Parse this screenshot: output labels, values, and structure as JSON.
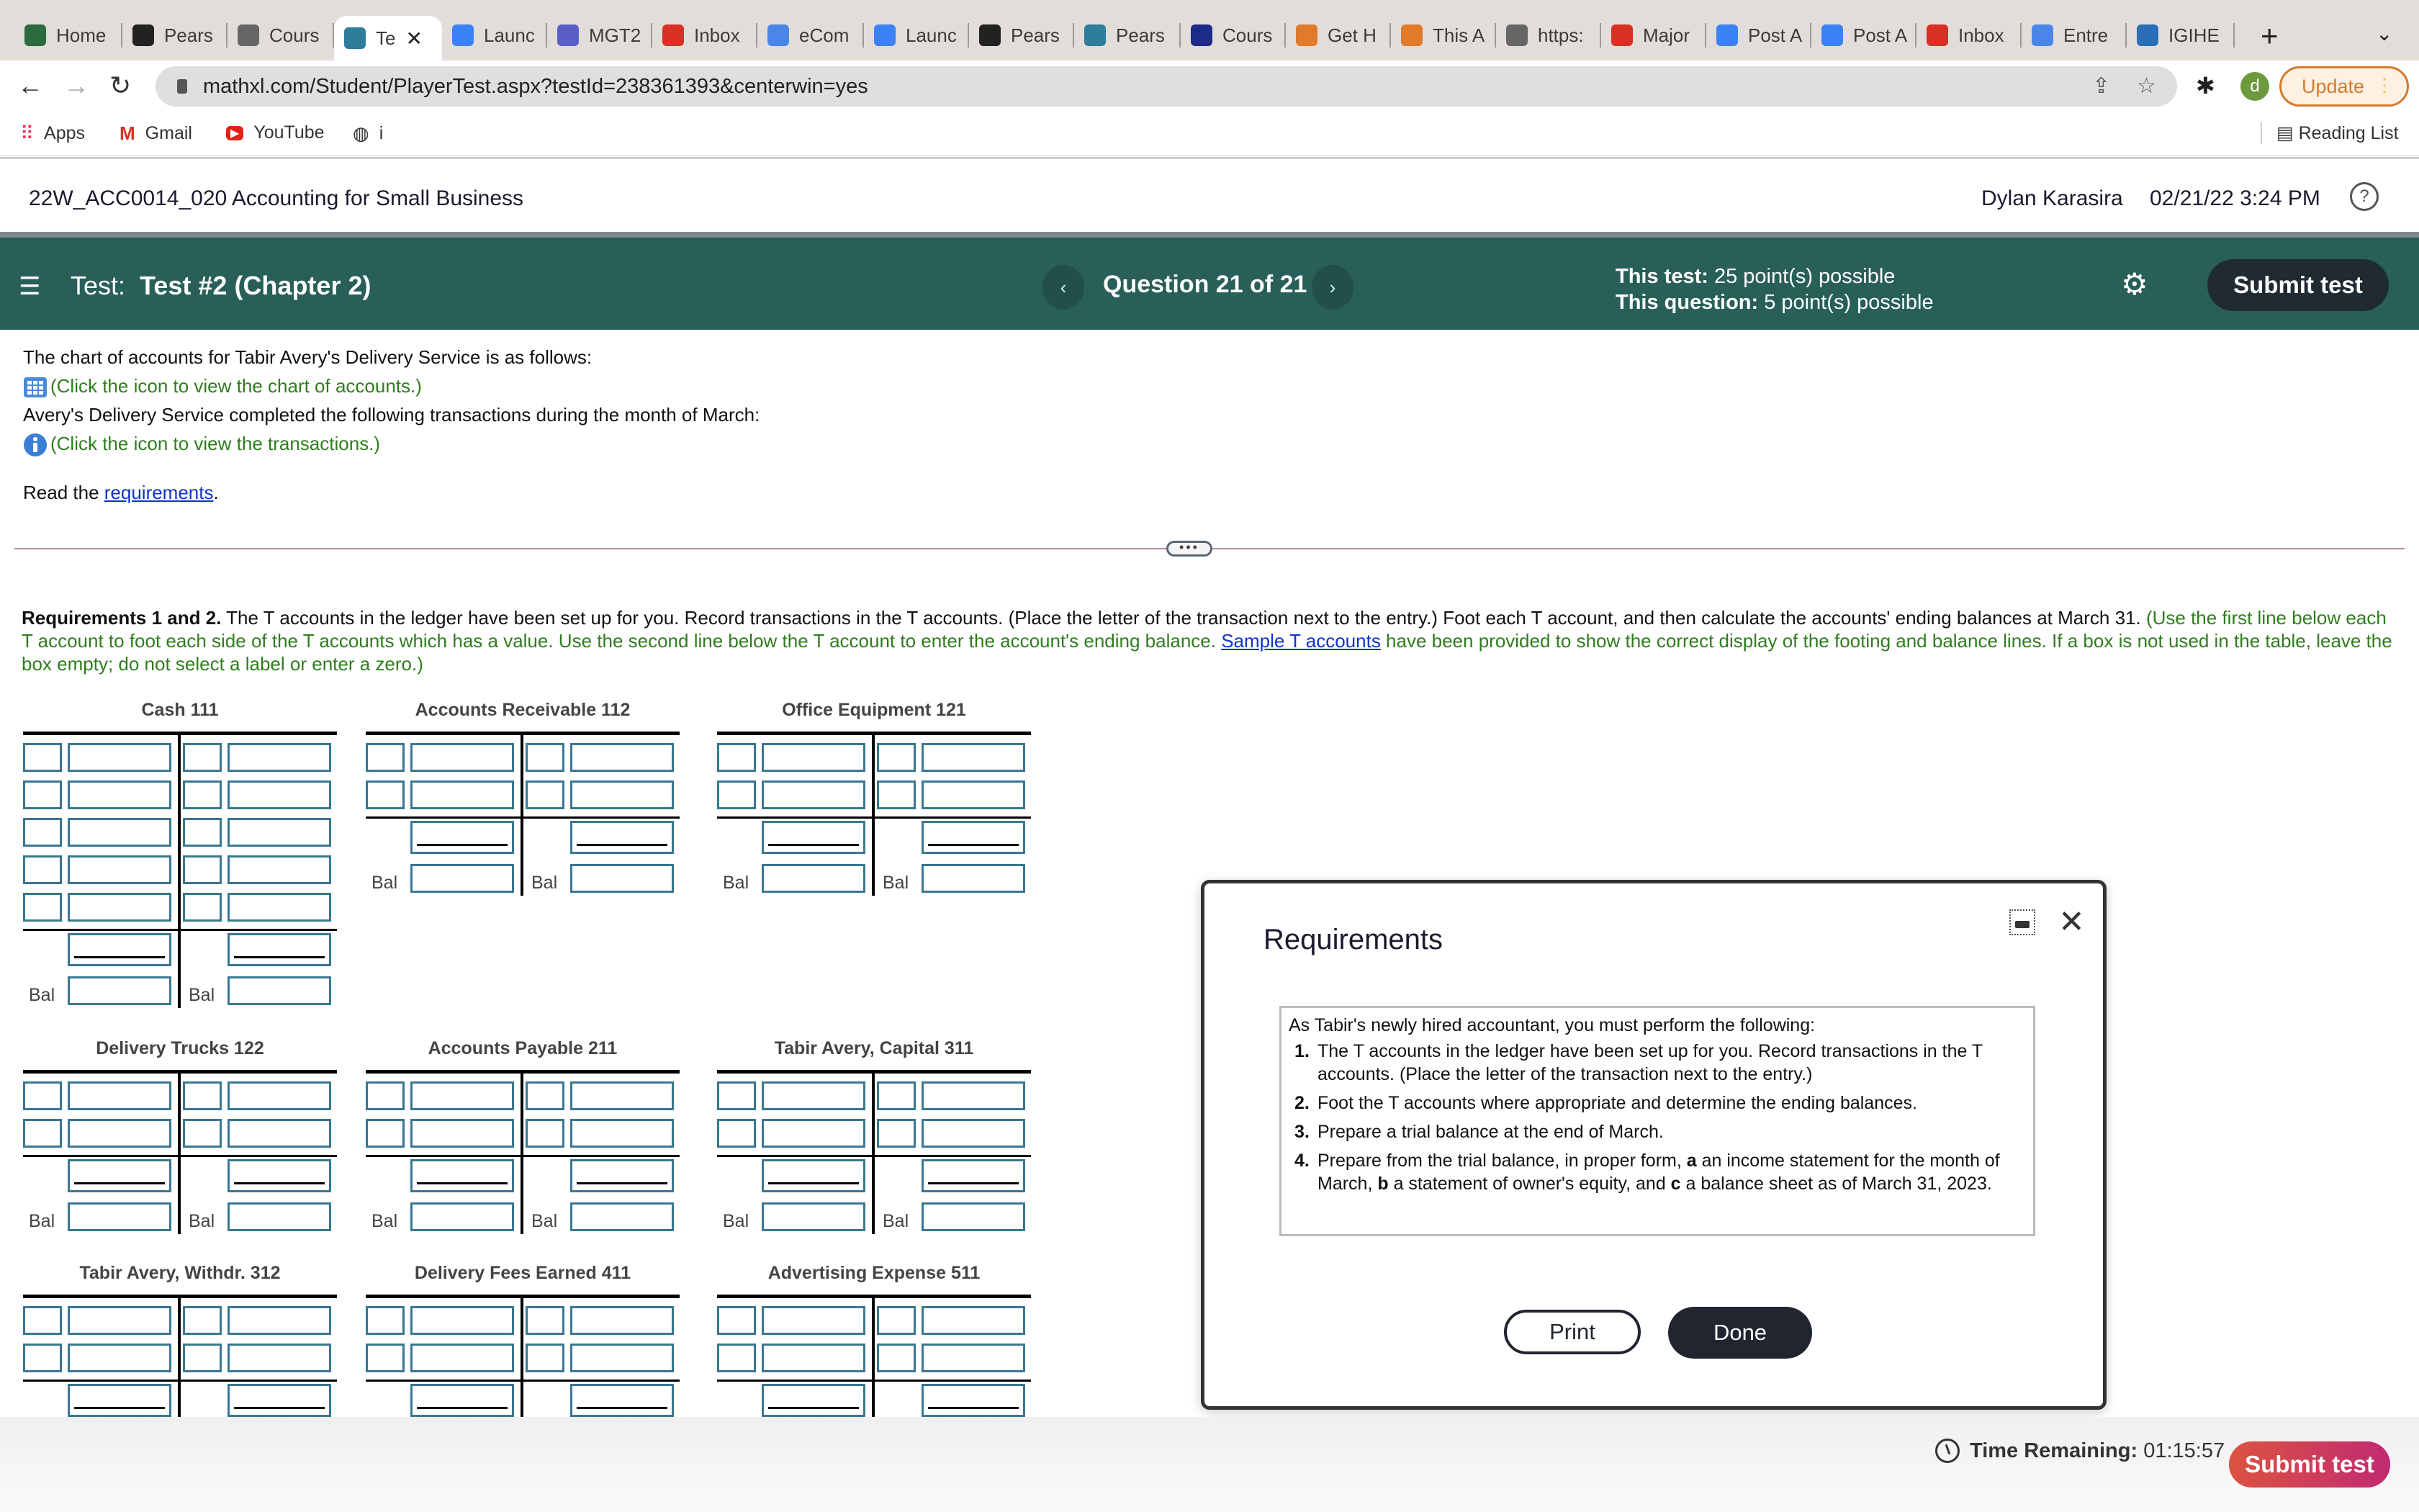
{
  "browser": {
    "tabs": [
      {
        "label": "Home",
        "icon": "ac-logo-icon",
        "color": "#2e6b3c"
      },
      {
        "label": "Pears",
        "icon": "globe-icon",
        "color": "#222"
      },
      {
        "label": "Cours",
        "icon": "page-icon",
        "color": "#666"
      },
      {
        "label": "Te",
        "icon": "pearson-icon",
        "color": "#2e7d9a",
        "active": true
      },
      {
        "label": "Launc",
        "icon": "zoom-icon",
        "color": "#3b82f6"
      },
      {
        "label": "MGT2",
        "icon": "teams-icon",
        "color": "#5a5fc8"
      },
      {
        "label": "Inbox",
        "icon": "gmail-icon",
        "color": "#d93025"
      },
      {
        "label": "eCom",
        "icon": "docs-icon",
        "color": "#4a86e8"
      },
      {
        "label": "Launc",
        "icon": "zoom-icon",
        "color": "#3b82f6"
      },
      {
        "label": "Pears",
        "icon": "globe-icon",
        "color": "#222"
      },
      {
        "label": "Pears",
        "icon": "pearson-icon",
        "color": "#2e7d9a"
      },
      {
        "label": "Cours",
        "icon": "shield-star-icon",
        "color": "#1c2a8a"
      },
      {
        "label": "Get H",
        "icon": "c-icon",
        "color": "#e07b2c"
      },
      {
        "label": "This A",
        "icon": "c-icon",
        "color": "#e07b2c"
      },
      {
        "label": "https:",
        "icon": "page-icon",
        "color": "#666"
      },
      {
        "label": "Major",
        "icon": "gmail-icon",
        "color": "#d93025"
      },
      {
        "label": "Post A",
        "icon": "zoom-icon",
        "color": "#3b82f6"
      },
      {
        "label": "Post A",
        "icon": "zoom-icon",
        "color": "#3b82f6"
      },
      {
        "label": "Inbox",
        "icon": "gmail-icon",
        "color": "#d93025"
      },
      {
        "label": "Entre",
        "icon": "docs-icon",
        "color": "#4a86e8"
      },
      {
        "label": "IGIHE",
        "icon": "wave-icon",
        "color": "#2a6fb5"
      }
    ],
    "url": "mathxl.com/Student/PlayerTest.aspx?testId=238361393&centerwin=yes",
    "profile_initial": "d",
    "update_label": "Update",
    "bookmarks": [
      {
        "label": "Apps",
        "icon": "apps-grid-icon"
      },
      {
        "label": "Gmail",
        "icon": "gmail-icon"
      },
      {
        "label": "YouTube",
        "icon": "youtube-icon"
      },
      {
        "label": "i",
        "icon": "globe-icon"
      }
    ],
    "reading_list": "Reading List"
  },
  "course": {
    "title": "22W_ACC0014_020 Accounting for Small Business",
    "user": "Dylan Karasira",
    "datetime": "02/21/22 3:24 PM"
  },
  "testbar": {
    "test_prefix": "Test:",
    "test_name": "Test #2 (Chapter 2)",
    "question_label": "Question 21 of 21",
    "this_test_label": "This test:",
    "this_test_value": "25 point(s) possible",
    "this_question_label": "This question:",
    "this_question_value": "5 point(s) possible",
    "submit_label": "Submit test"
  },
  "intro": {
    "line1": "The chart of accounts for Tabir Avery's Delivery Service is as follows:",
    "line2": "(Click the icon to view the chart of accounts.)",
    "line3": "Avery's Delivery Service completed the following transactions during the month of March:",
    "line4": "(Click the icon to view the transactions.)",
    "read_prefix": "Read the ",
    "read_link": "requirements",
    "read_suffix": "."
  },
  "requirements_text": {
    "bold": "Requirements 1 and 2.",
    "main": " The T accounts in the ledger have been set up for you. Record transactions in the T accounts. (Place the letter of the transaction next to the entry.) Foot each T account, and then calculate the accounts' ending balances at March 31. ",
    "green1": "(Use the first line below each T account to foot each side of the T accounts which has a value. Use the second line below the T account to enter the account's ending balance. ",
    "link": "Sample T accounts",
    "green2": " have been provided to show the correct display of the footing and balance lines. If a box is not used in the table, leave the box empty; do not select a label or enter a zero.)"
  },
  "t_accounts": [
    {
      "name": "Cash 111",
      "entry_rows": 5
    },
    {
      "name": "Accounts Receivable 112",
      "entry_rows": 2
    },
    {
      "name": "Office Equipment 121",
      "entry_rows": 2
    },
    {
      "name": "Delivery Trucks 122",
      "entry_rows": 2
    },
    {
      "name": "Accounts Payable 211",
      "entry_rows": 2
    },
    {
      "name": "Tabir Avery, Capital 311",
      "entry_rows": 2
    },
    {
      "name": "Tabir Avery, Withdr. 312",
      "entry_rows": 2
    },
    {
      "name": "Delivery Fees Earned 411",
      "entry_rows": 2
    },
    {
      "name": "Advertising Expense 511",
      "entry_rows": 2
    }
  ],
  "bal_label": "Bal",
  "modal": {
    "title": "Requirements",
    "intro": "As Tabir's newly hired accountant, you must perform the following:",
    "items": [
      {
        "num": "1.",
        "text": "The T accounts in the ledger have been set up for you. Record transactions in the T accounts. (Place the letter of the transaction next to the entry.)"
      },
      {
        "num": "2.",
        "text": "Foot the T accounts where appropriate and determine the ending balances."
      },
      {
        "num": "3.",
        "text": "Prepare a trial balance at the end of March."
      },
      {
        "num": "4.",
        "text_html": "Prepare from the trial balance, in proper form, <b>a</b> an income statement for the month of March, <b>b</b> a statement of owner's equity, and <b>c</b> a balance sheet as of March 31, 2023."
      }
    ],
    "print_label": "Print",
    "done_label": "Done"
  },
  "footer": {
    "time_label": "Time Remaining:",
    "time_value": "01:15:57",
    "submit_label": "Submit test"
  }
}
